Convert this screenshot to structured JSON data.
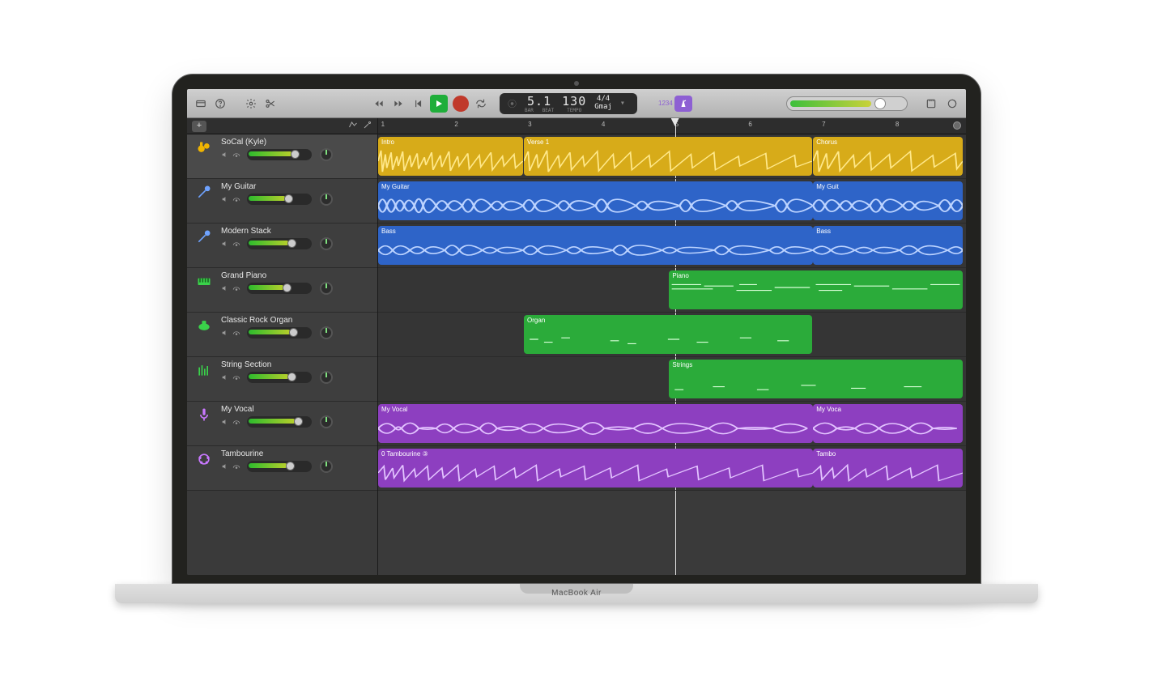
{
  "device_label": "MacBook Air",
  "transport": {
    "bar": "5",
    "beat": "1",
    "tempo": "130",
    "time_sig": "4/4",
    "key": "Gmaj",
    "bar_label": "BAR",
    "beat_label": "BEAT",
    "tempo_label": "TEMPO",
    "countin_label": "1234"
  },
  "ruler": {
    "markers": [
      "1",
      "2",
      "3",
      "4",
      "5",
      "6",
      "7",
      "8"
    ],
    "playhead_marker": "5"
  },
  "regions": {
    "drum_a": "Intro",
    "drum_b": "Verse 1",
    "drum_c": "Chorus",
    "guitar_a": "My Guitar",
    "guitar_b": "My Guit",
    "bass_a": "Bass",
    "bass_b": "Bass",
    "piano": "Piano",
    "organ": "Organ",
    "strings": "Strings",
    "vocal_a": "My Vocal",
    "vocal_b": "My Voca",
    "tamb_a": "0 Tambourine ③",
    "tamb_b": "Tambo"
  },
  "tracks": [
    {
      "name": "SoCal (Kyle)",
      "color": "#f0b400",
      "vol": 54
    },
    {
      "name": "My Guitar",
      "color": "#4f87ff",
      "vol": 46
    },
    {
      "name": "Modern Stack",
      "color": "#4f87ff",
      "vol": 50
    },
    {
      "name": "Grand Piano",
      "color": "#2bd24a",
      "vol": 44
    },
    {
      "name": "Classic Rock Organ",
      "color": "#2bd24a",
      "vol": 52
    },
    {
      "name": "String Section",
      "color": "#2bd24a",
      "vol": 50
    },
    {
      "name": "My Vocal",
      "color": "#b960ff",
      "vol": 58
    },
    {
      "name": "Tambourine",
      "color": "#b960ff",
      "vol": 48
    }
  ]
}
